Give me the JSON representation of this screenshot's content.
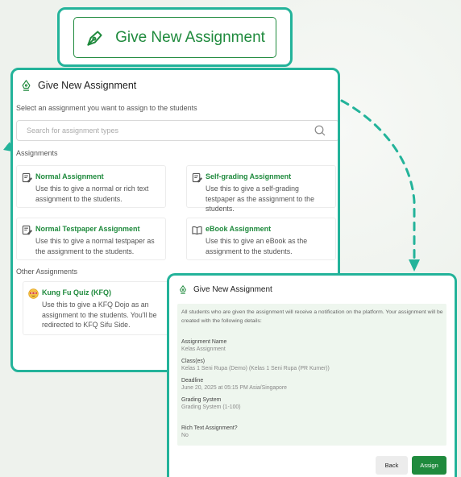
{
  "colors": {
    "accent": "#1f8a3d",
    "frame": "#23b39a",
    "panel_body": "#eef6ee",
    "background": "#eef2ed"
  },
  "hero": {
    "label": "Give New Assignment",
    "icon": "pen-nib-icon"
  },
  "panel1": {
    "title": "Give New Assignment",
    "subtitle": "Select an assignment you want to assign to the students",
    "search_placeholder": "Search for assignment types",
    "section_assignments": "Assignments",
    "section_other": "Other Assignments",
    "cards": [
      {
        "icon": "edit-doc-icon",
        "title": "Normal Assignment",
        "desc": "Use this to give a normal or rich text assignment to the students."
      },
      {
        "icon": "edit-doc-icon",
        "title": "Self-grading Assignment",
        "desc": "Use this to give a self-grading testpaper as the assignment to the students."
      },
      {
        "icon": "edit-doc-icon",
        "title": "Normal Testpaper Assignment",
        "desc": "Use this to give a normal testpaper as the assignment to the students."
      },
      {
        "icon": "open-book-icon",
        "title": "eBook Assignment",
        "desc": "Use this to give an eBook as the assignment to the students."
      },
      {
        "icon": "kfq-mascot-icon",
        "title": "Kung Fu Quiz (KFQ)",
        "desc": "Use this to give a KFQ Dojo as an assignment to the students. You'll be redirected to KFQ Sifu Side."
      }
    ]
  },
  "panel2": {
    "title": "Give New Assignment",
    "notice": "All students who are given the assignment will receive a notification on the platform. Your assignment will be created with the following details:",
    "details": [
      {
        "label": "Assignment Name",
        "value": "Kelas Assignment"
      },
      {
        "label": "Class(es)",
        "value": "Kelas 1 Seni Rupa (Demo) (Kelas 1 Seni Rupa (PR Kumer))"
      },
      {
        "label": "Deadline",
        "value": "June 20, 2025 at 05:15 PM Asia/Singapore"
      },
      {
        "label": "Grading System",
        "value": "Grading System (1-100)"
      },
      {
        "label": "Rich Text Assignment?",
        "value": "No"
      }
    ],
    "back_label": "Back",
    "assign_label": "Assign"
  }
}
